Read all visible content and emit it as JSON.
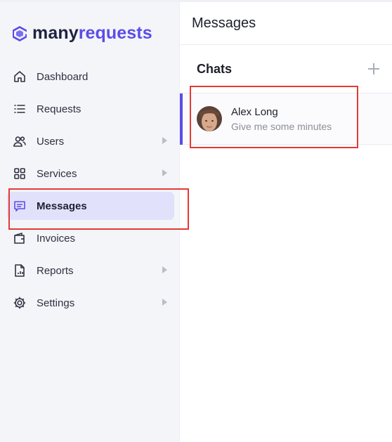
{
  "brand": {
    "name_part1": "many",
    "name_part2": "requests",
    "color": "#5b4de8"
  },
  "sidebar": {
    "items": [
      {
        "label": "Dashboard",
        "icon": "home-icon",
        "has_submenu": false
      },
      {
        "label": "Requests",
        "icon": "list-icon",
        "has_submenu": false
      },
      {
        "label": "Users",
        "icon": "users-icon",
        "has_submenu": true
      },
      {
        "label": "Services",
        "icon": "grid-icon",
        "has_submenu": true
      },
      {
        "label": "Messages",
        "icon": "message-icon",
        "has_submenu": false,
        "active": true
      },
      {
        "label": "Invoices",
        "icon": "wallet-icon",
        "has_submenu": false
      },
      {
        "label": "Reports",
        "icon": "report-icon",
        "has_submenu": true
      },
      {
        "label": "Settings",
        "icon": "gear-icon",
        "has_submenu": true
      }
    ]
  },
  "panel": {
    "title": "Messages",
    "chats_heading": "Chats",
    "add_icon": "plus-icon",
    "chats": [
      {
        "name": "Alex Long",
        "preview": "Give me some minutes"
      }
    ]
  },
  "colors": {
    "accent": "#5b4de8",
    "active_bg": "#e2e1fb",
    "highlight": "#e53935"
  }
}
